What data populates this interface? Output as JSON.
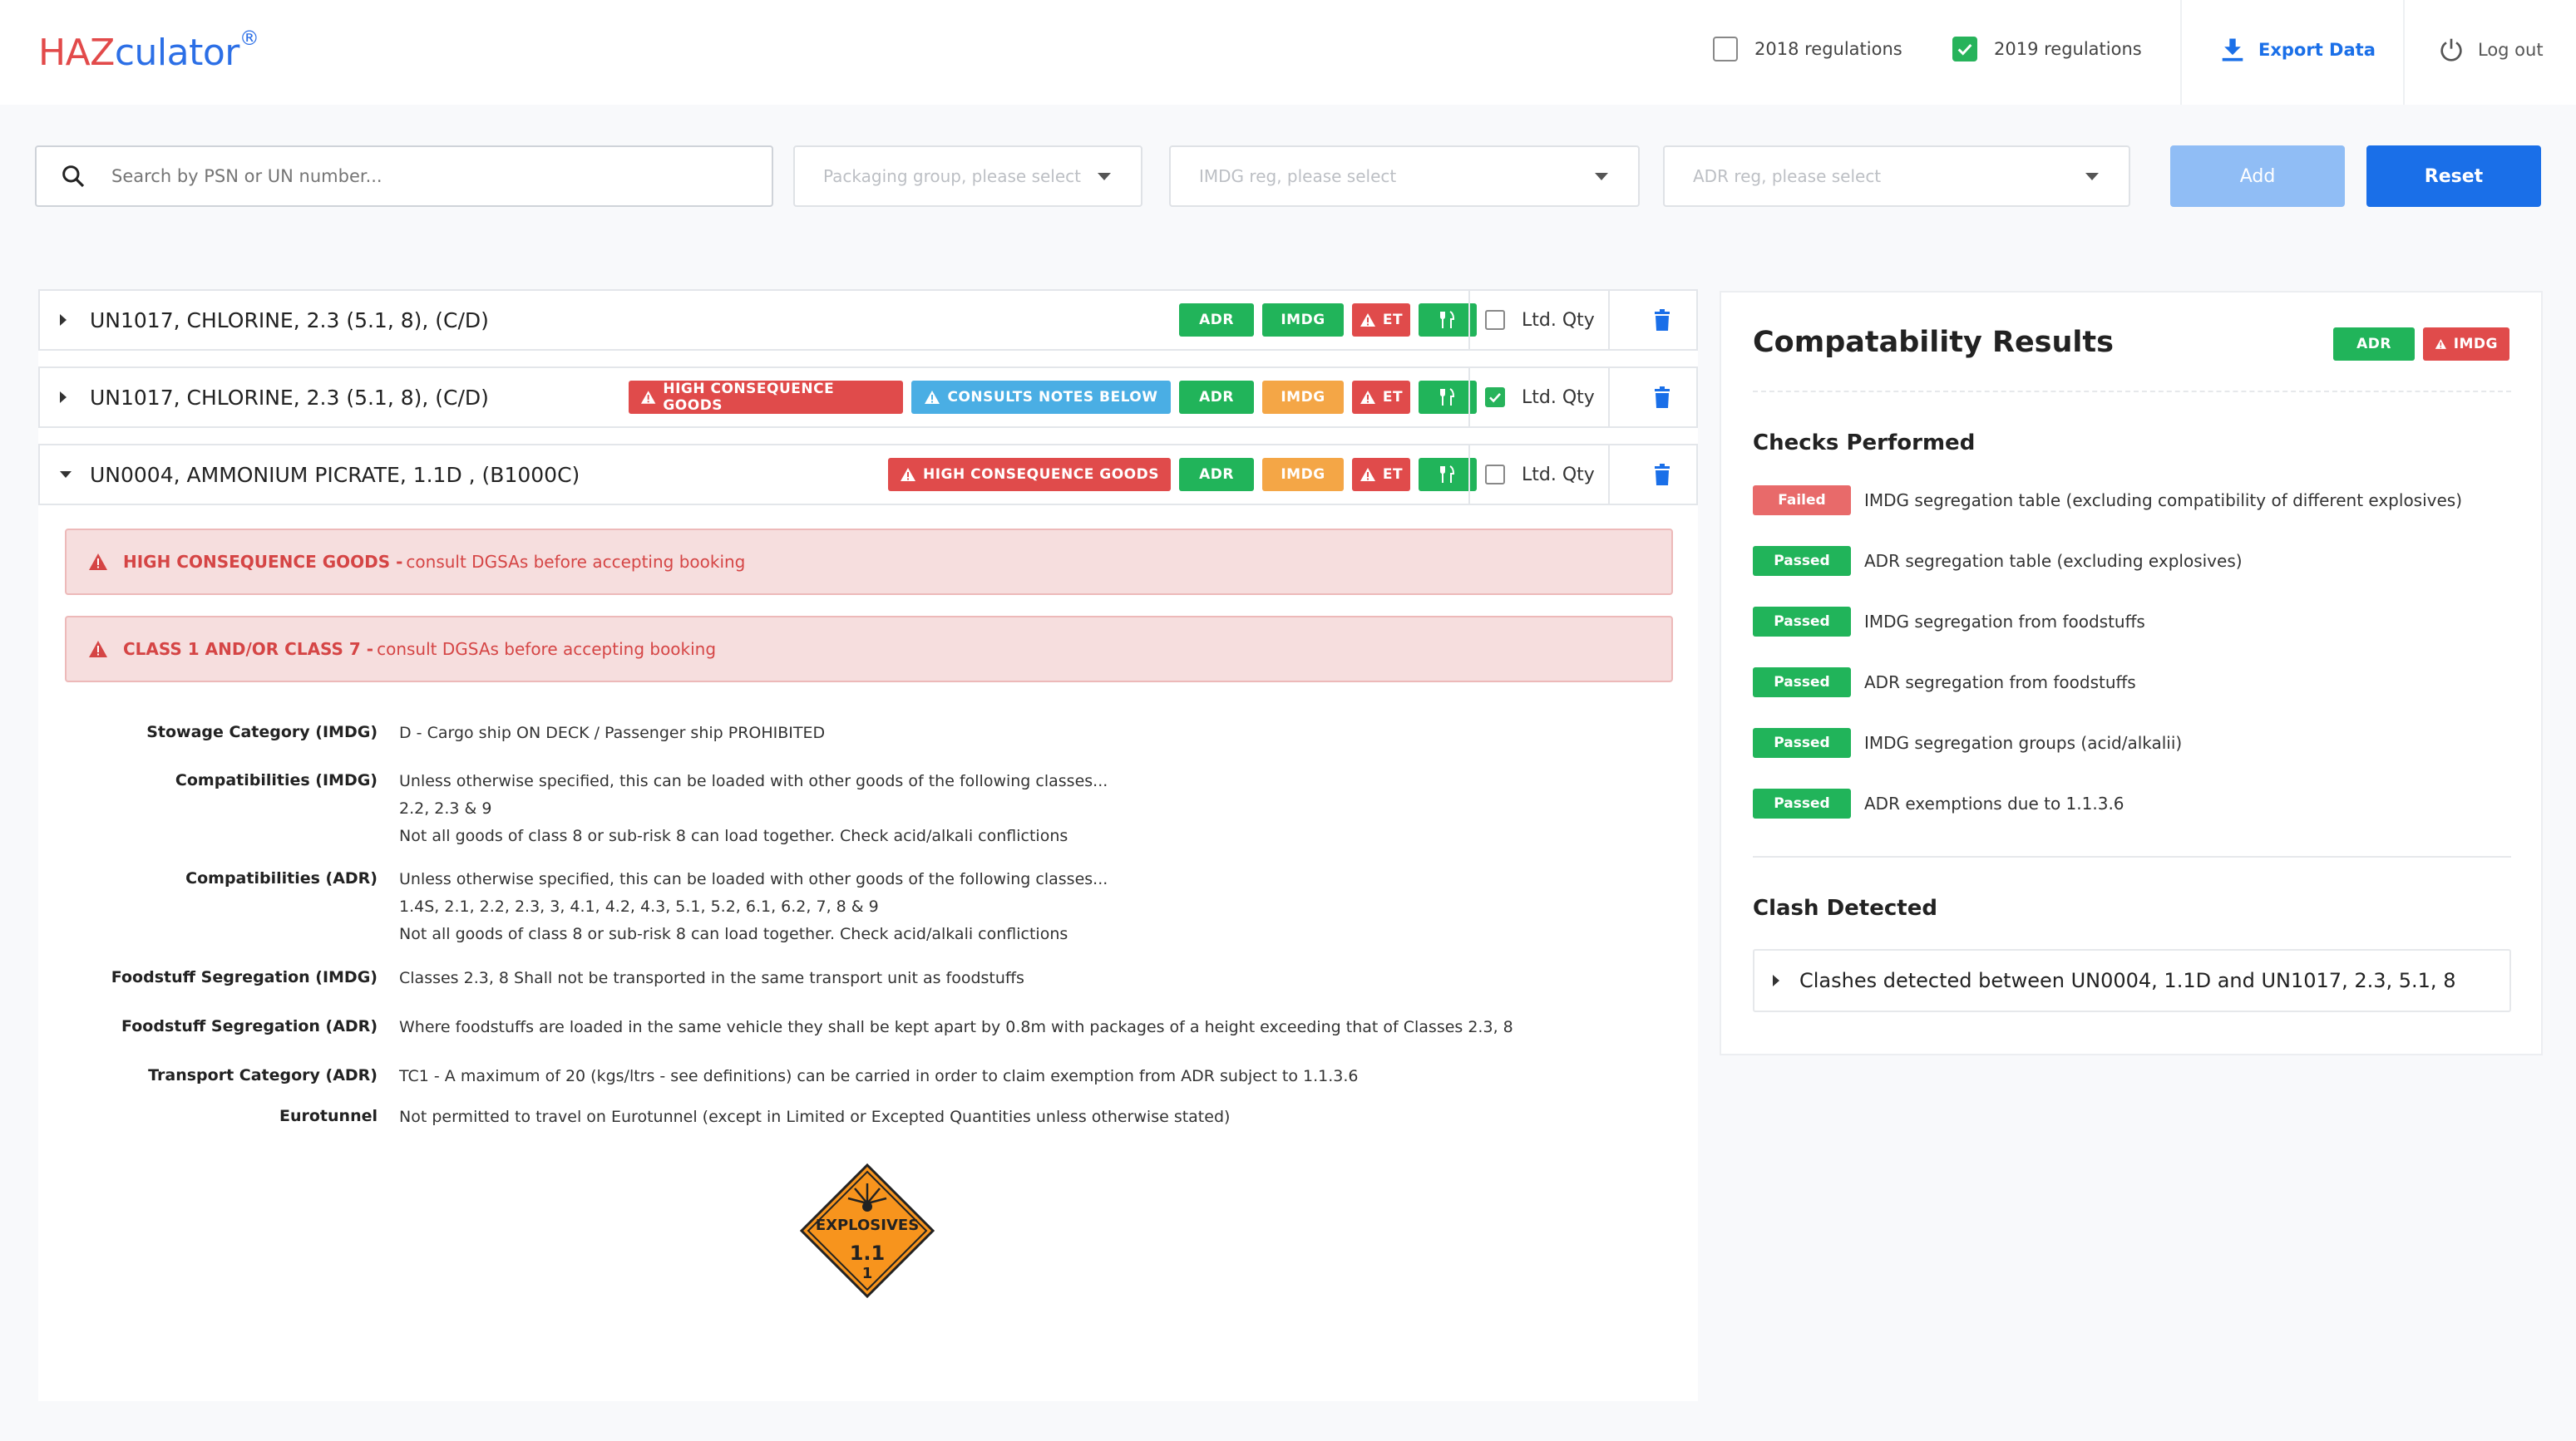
{
  "header": {
    "logo_haz": "HAZ",
    "logo_culator": "culator",
    "logo_mark": "®",
    "reg_2018": "2018 regulations",
    "reg_2018_checked": false,
    "reg_2019": "2019 regulations",
    "reg_2019_checked": true,
    "export": "Export Data",
    "logout": "Log out"
  },
  "search": {
    "placeholder": "Search by PSN or UN number...",
    "packaging": "Packaging group, please select",
    "imdg": "IMDG reg, please select",
    "adr": "ADR reg, please select",
    "add": "Add",
    "reset": "Reset"
  },
  "rows": [
    {
      "name": "UN1017, CHLORINE, 2.3 (5.1, 8), (C/D)",
      "tags": {
        "adr": "ADR",
        "imdg": "IMDG",
        "et": "ET"
      },
      "ltd": "Ltd. Qty",
      "ltd_checked": false
    },
    {
      "name": "UN1017, CHLORINE, 2.3 (5.1, 8), (C/D)",
      "tags": {
        "hcg": "HIGH CONSEQUENCE GOODS",
        "notes": "CONSULTS NOTES BELOW",
        "adr": "ADR",
        "imdg": "IMDG",
        "et": "ET"
      },
      "ltd": "Ltd. Qty",
      "ltd_checked": true
    },
    {
      "name": "UN0004, AMMONIUM PICRATE, 1.1D , (B1000C)",
      "tags": {
        "hcg": "HIGH CONSEQUENCE GOODS",
        "adr": "ADR",
        "imdg": "IMDG",
        "et": "ET"
      },
      "ltd": "Ltd. Qty",
      "ltd_checked": false
    }
  ],
  "alerts": [
    {
      "strong": "HIGH CONSEQUENCE GOODS -",
      "text": "consult DGSAs before accepting booking"
    },
    {
      "strong": "CLASS 1 AND/OR CLASS 7 -",
      "text": "consult DGSAs before accepting booking"
    }
  ],
  "details": {
    "stowage": {
      "label": "Stowage Category (IMDG)",
      "value": "D - Cargo ship ON DECK / Passenger ship PROHIBITED"
    },
    "comp_imdg": {
      "label": "Compatibilities (IMDG)",
      "l1": "Unless otherwise specified, this can be loaded with other goods of the following classes...",
      "l2": "2.2, 2.3 & 9",
      "l3": "Not all goods of class 8 or sub-risk 8 can load together. Check acid/alkali conflictions"
    },
    "comp_adr": {
      "label": "Compatibilities (ADR)",
      "l1": "Unless otherwise specified, this can be loaded with other goods of the following classes...",
      "l2": "1.4S, 2.1, 2.2, 2.3, 3, 4.1, 4.2, 4.3, 5.1, 5.2, 6.1, 6.2, 7, 8 & 9",
      "l3": "Not all goods of class 8 or sub-risk 8 can load together. Check acid/alkali conflictions"
    },
    "food_imdg": {
      "label": "Foodstuff Segregation (IMDG)",
      "value": "Classes 2.3, 8 Shall not be transported in the same transport unit as foodstuffs"
    },
    "food_adr": {
      "label": "Foodstuff Segregation (ADR)",
      "value": "Where foodstuffs are loaded in the same vehicle they shall be kept apart by 0.8m with packages of a height exceeding that of Classes 2.3, 8"
    },
    "transport": {
      "label": "Transport Category (ADR)",
      "value": "TC1 - A maximum of 20 (kgs/ltrs - see definitions) can be carried in order to claim exemption from ADR subject to 1.1.3.6"
    },
    "eurotunnel": {
      "label": "Eurotunnel",
      "value": "Not permitted to travel on Eurotunnel (except in Limited or Excepted Quantities unless otherwise stated)"
    }
  },
  "placard": {
    "word": "EXPLOSIVES",
    "number": "1.1",
    "sub": "1"
  },
  "results": {
    "title": "Compatability Results",
    "adr": "ADR",
    "imdg": "IMDG",
    "checks_title": "Checks Performed",
    "checks": [
      {
        "status": "Failed",
        "text": "IMDG segregation table (excluding compatibility of different explosives)"
      },
      {
        "status": "Passed",
        "text": "ADR segregation table (excluding explosives)"
      },
      {
        "status": "Passed",
        "text": "IMDG segregation from foodstuffs"
      },
      {
        "status": "Passed",
        "text": "ADR segregation from foodstuffs"
      },
      {
        "status": "Passed",
        "text": "IMDG segregation groups (acid/alkalii)"
      },
      {
        "status": "Passed",
        "text": "ADR exemptions due to 1.1.3.6"
      }
    ],
    "clash_title": "Clash Detected",
    "clash": "Clashes detected between UN0004, 1.1D and UN1017, 2.3, 5.1, 8"
  },
  "colors": {
    "brand_red": "#e24a4a",
    "brand_blue": "#1a6fe8",
    "green": "#21b45a",
    "orange": "#f4a646",
    "red": "#e04b4b",
    "light_blue": "#4aaee4",
    "placard_orange": "#f7941d"
  }
}
